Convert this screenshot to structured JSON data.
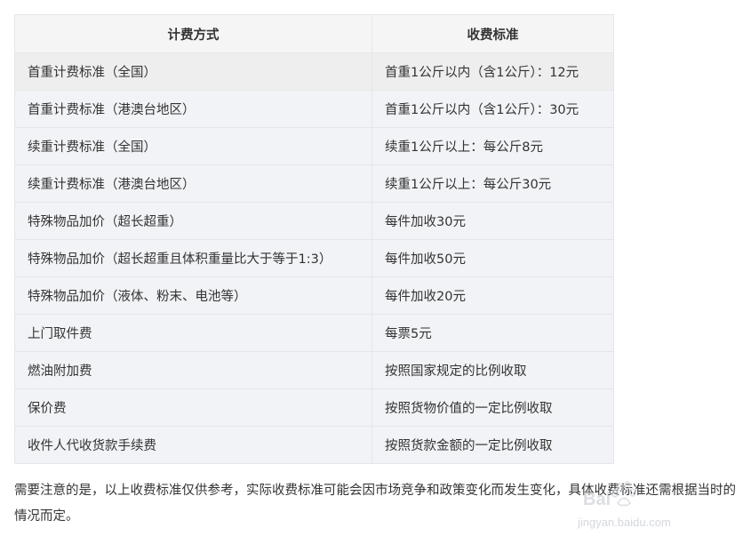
{
  "table": {
    "headers": [
      "计费方式",
      "收费标准"
    ],
    "rows": [
      {
        "method": "首重计费标准（全国）",
        "fee": "首重1公斤以内（含1公斤）：12元"
      },
      {
        "method": "首重计费标准（港澳台地区）",
        "fee": "首重1公斤以内（含1公斤）：30元"
      },
      {
        "method": "续重计费标准（全国）",
        "fee": "续重1公斤以上：每公斤8元"
      },
      {
        "method": "续重计费标准（港澳台地区）",
        "fee": "续重1公斤以上：每公斤30元"
      },
      {
        "method": "特殊物品加价（超长超重）",
        "fee": "每件加收30元"
      },
      {
        "method": "特殊物品加价（超长超重且体积重量比大于等于1:3）",
        "fee": "每件加收50元"
      },
      {
        "method": "特殊物品加价（液体、粉末、电池等）",
        "fee": "每件加收20元"
      },
      {
        "method": "上门取件费",
        "fee": "每票5元"
      },
      {
        "method": "燃油附加费",
        "fee": "按照国家规定的比例收取"
      },
      {
        "method": "保价费",
        "fee": "按照货物价值的一定比例收取"
      },
      {
        "method": "收件人代收货款手续费",
        "fee": "按照货款金额的一定比例收取"
      }
    ]
  },
  "note": "需要注意的是，以上收费标准仅供参考，实际收费标准可能会因市场竞争和政策变化而发生变化，具体收费标准还需根据当时的情况而定。",
  "watermark": {
    "brand": "Bai",
    "url": "jingyan.baidu.com"
  }
}
